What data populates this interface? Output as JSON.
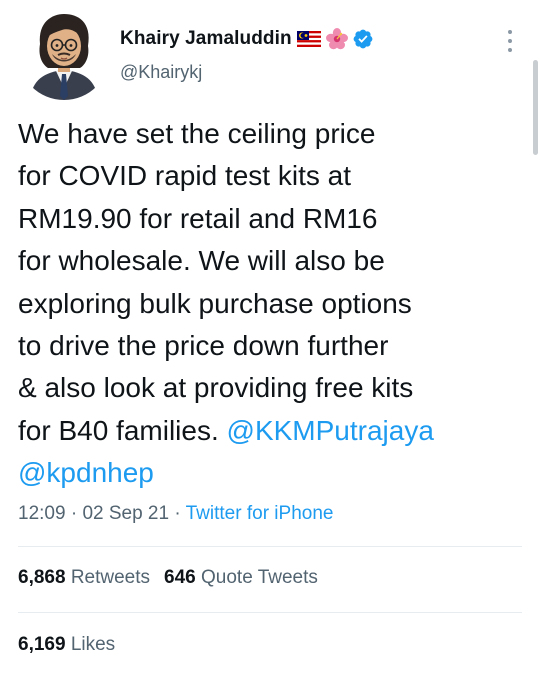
{
  "author": {
    "display_name": "Khairy Jamaluddin",
    "handle": "@Khairykj",
    "emoji": [
      "malaysia-flag-icon",
      "hibiscus-flower-icon"
    ],
    "verified": true
  },
  "tweet": {
    "lines": [
      "We have set the ceiling price",
      "for COVID rapid test kits at",
      "RM19.90 for retail and RM16",
      "for wholesale. We will also be",
      "exploring bulk purchase options",
      "to drive the price down further",
      "& also look at providing free kits",
      "for B40 families."
    ],
    "mentions": [
      "@KKMPutrajaya",
      "@kpdnhep"
    ]
  },
  "meta": {
    "time": "12:09",
    "separator": "·",
    "date": "02 Sep 21",
    "source": "Twitter for iPhone"
  },
  "stats": {
    "retweets_count": "6,868",
    "retweets_label": "Retweets",
    "quote_count": "646",
    "quote_label": "Quote Tweets",
    "likes_count": "6,169",
    "likes_label": "Likes"
  },
  "colors": {
    "link": "#1d9bf0",
    "secondary": "#536471",
    "primary": "#0f1419",
    "verified": "#1d9bf0"
  }
}
